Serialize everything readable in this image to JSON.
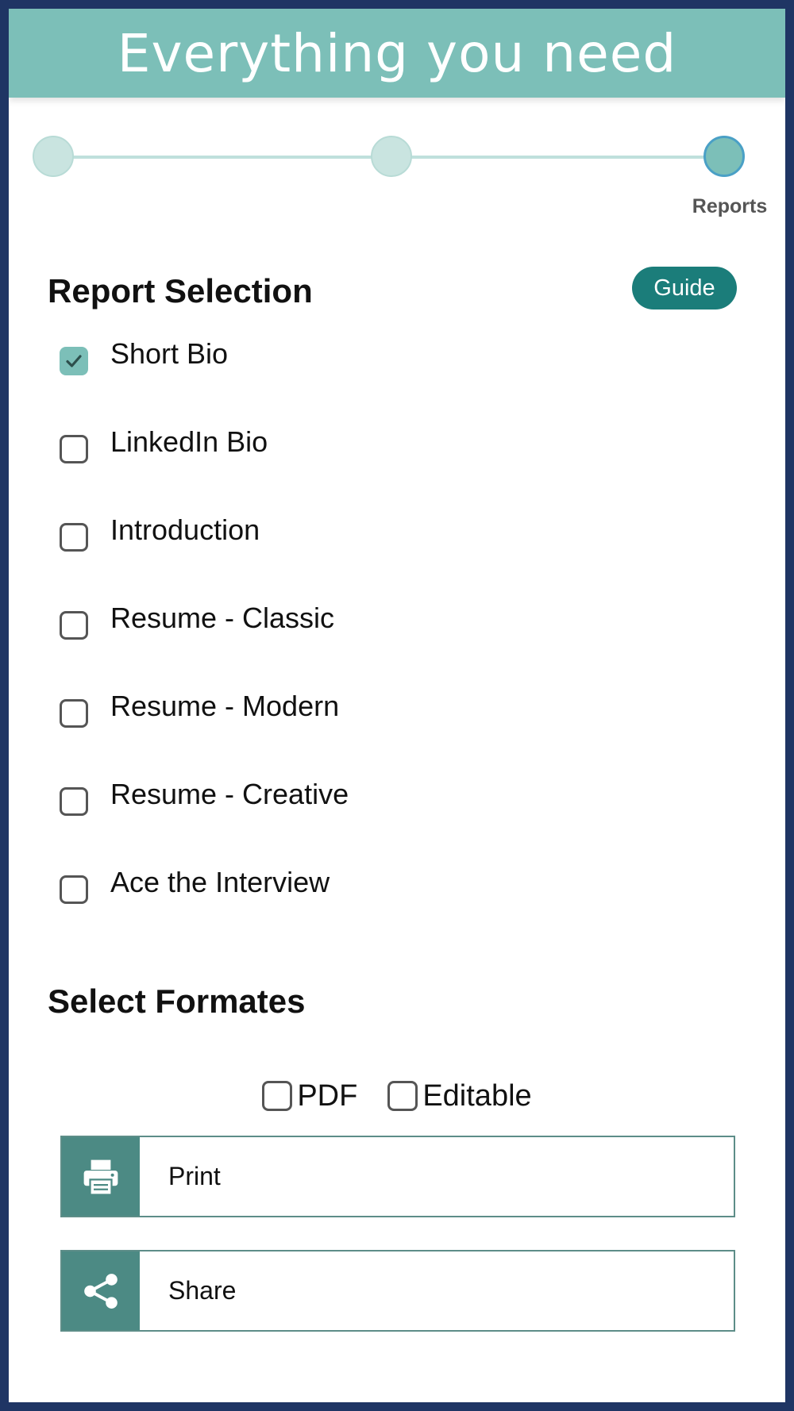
{
  "header": {
    "title": "Everything you need"
  },
  "stepper": {
    "active_step_label": "Reports"
  },
  "report_section": {
    "title": "Report Selection",
    "guide_label": "Guide",
    "items": [
      {
        "label": "Short Bio",
        "checked": true
      },
      {
        "label": "LinkedIn Bio",
        "checked": false
      },
      {
        "label": "Introduction",
        "checked": false
      },
      {
        "label": "Resume - Classic",
        "checked": false
      },
      {
        "label": "Resume - Modern",
        "checked": false
      },
      {
        "label": "Resume - Creative",
        "checked": false
      },
      {
        "label": "Ace the Interview",
        "checked": false
      }
    ]
  },
  "format_section": {
    "title": "Select Formates",
    "options": [
      {
        "label": "PDF",
        "checked": false
      },
      {
        "label": "Editable",
        "checked": false
      }
    ]
  },
  "actions": {
    "print": {
      "label": "Print",
      "icon": "printer-icon"
    },
    "share": {
      "label": "Share",
      "icon": "share-icon"
    }
  },
  "colors": {
    "header_bg": "#7cbfb8",
    "accent": "#1b7d7a",
    "icon_box": "#4c8a84",
    "frame_border": "#1f3564"
  }
}
